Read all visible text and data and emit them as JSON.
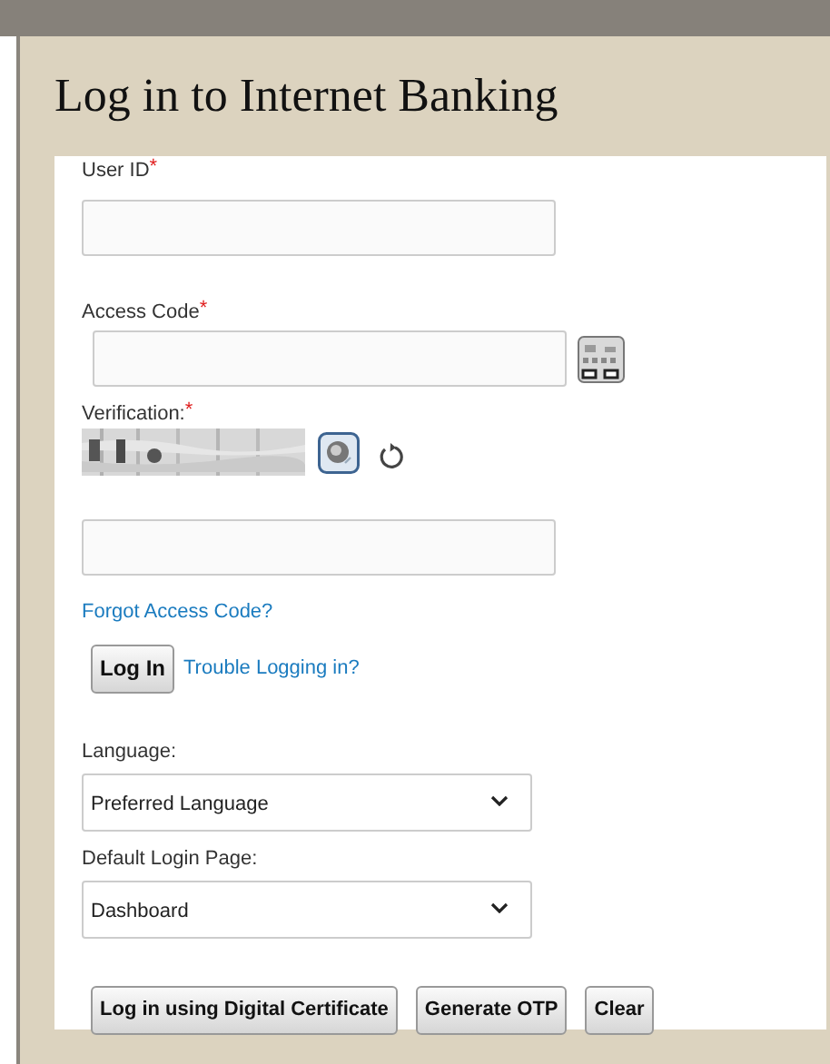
{
  "title": "Log in to Internet Banking",
  "fields": [
    {
      "kind": "text",
      "label": "User ID",
      "required_mark": "*"
    },
    {
      "kind": "keyboard",
      "label": "Access Code",
      "required_mark": "*"
    },
    {
      "kind": "captcha",
      "label": "Verification:",
      "required_mark": "*"
    }
  ],
  "forgot_link": "Forgot Access Code?",
  "login_button": "Log In",
  "trouble_link": "Trouble Logging in?",
  "selects": [
    {
      "label": "Language:",
      "value": "Preferred Language"
    },
    {
      "label": "Default Login Page:",
      "value": "Dashboard"
    }
  ],
  "buttons": [
    "Log in using Digital Certificate",
    "Generate OTP",
    "Clear"
  ]
}
